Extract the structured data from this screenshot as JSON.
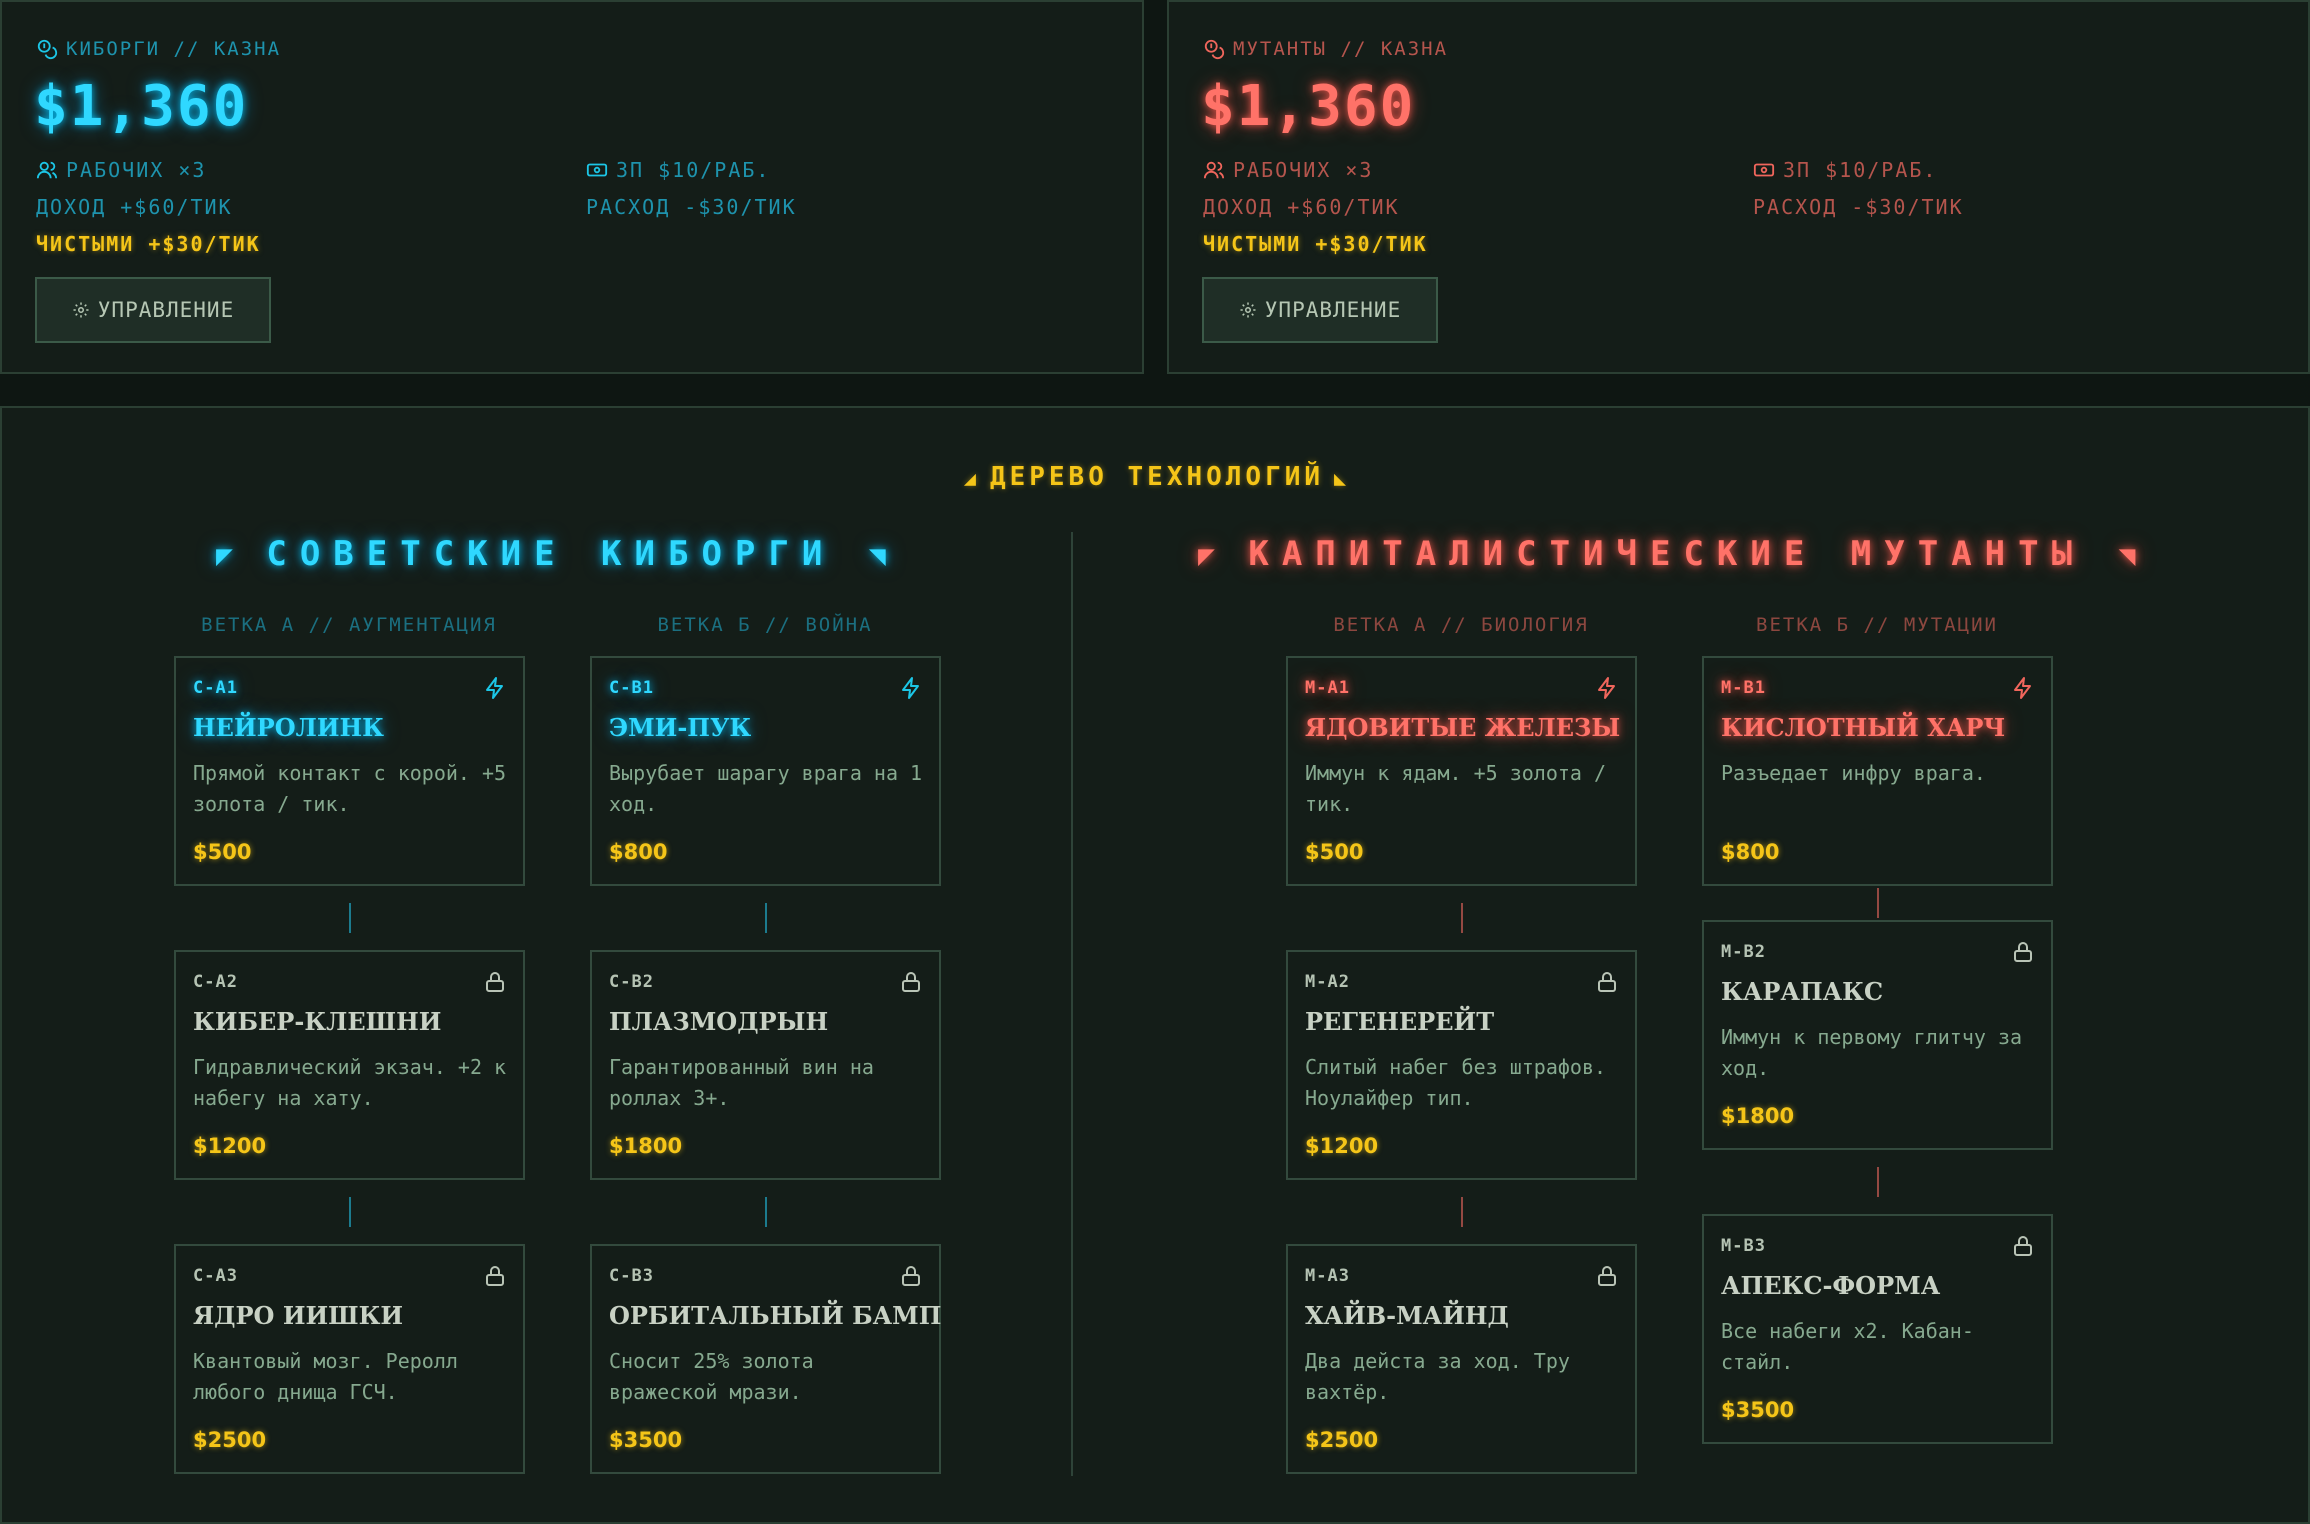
{
  "cyborgs": {
    "title": "КИБОРГИ // КАЗНА",
    "amount": "$1,360",
    "workers": "РАБОЧИХ ×3",
    "salary": "ЗП $10/РАБ.",
    "income": "ДОХОД +$60/ТИК",
    "expense": "РАСХОД -$30/ТИК",
    "net": "ЧИСТЫМИ +$30/ТИК",
    "manage": "УПРАВЛЕНИЕ"
  },
  "mutants": {
    "title": "МУТАНТЫ // КАЗНА",
    "amount": "$1,360",
    "workers": "РАБОЧИХ ×3",
    "salary": "ЗП $10/РАБ.",
    "income": "ДОХОД +$60/ТИК",
    "expense": "РАСХОД -$30/ТИК",
    "net": "ЧИСТЫМИ +$30/ТИК",
    "manage": "УПРАВЛЕНИЕ"
  },
  "tree": {
    "title": "ДЕРЕВО ТЕХНОЛОГИЙ",
    "cyborgs": {
      "faction": "СОВЕТСКИЕ КИБОРГИ",
      "branch_a": {
        "label": "ВЕТКА А // АУГМЕНТАЦИЯ",
        "cards": [
          {
            "id": "C-A1",
            "name": "НЕЙРОЛИНК",
            "desc": "Прямой контакт с корой. +5 золота / тик.",
            "price": "$500",
            "status": "available"
          },
          {
            "id": "C-A2",
            "name": "КИБЕР-КЛЕШНИ",
            "desc": "Гидравлический экзач. +2 к набегу на хату.",
            "price": "$1200",
            "status": "locked"
          },
          {
            "id": "C-A3",
            "name": "ЯДРО ИИШКИ",
            "desc": "Квантовый мозг. Реролл любого днища ГСЧ.",
            "price": "$2500",
            "status": "locked"
          }
        ]
      },
      "branch_b": {
        "label": "ВЕТКА Б // ВОЙНА",
        "cards": [
          {
            "id": "C-B1",
            "name": "ЭМИ-ПУК",
            "desc": "Вырубает шарагу врага на 1 ход.",
            "price": "$800",
            "status": "available"
          },
          {
            "id": "C-B2",
            "name": "ПЛАЗМОДРЫН",
            "desc": "Гарантированный вин на роллах 3+.",
            "price": "$1800",
            "status": "locked"
          },
          {
            "id": "C-B3",
            "name": "ОРБИТАЛЬНЫЙ БАМП",
            "desc": "Сносит 25% золота вражеской мрази.",
            "price": "$3500",
            "status": "locked"
          }
        ]
      }
    },
    "mutants": {
      "faction": "КАПИТАЛИСТИЧЕСКИЕ МУТАНТЫ",
      "branch_a": {
        "label": "ВЕТКА А // БИОЛОГИЯ",
        "cards": [
          {
            "id": "M-A1",
            "name": "ЯДОВИТЫЕ ЖЕЛЕЗЫ",
            "desc": "Иммун к ядам. +5 золота / тик.",
            "price": "$500",
            "status": "available"
          },
          {
            "id": "M-A2",
            "name": "РЕГЕНЕРЕЙТ",
            "desc": "Слитый набег без штрафов. Ноулайфер тип.",
            "price": "$1200",
            "status": "locked"
          },
          {
            "id": "M-A3",
            "name": "ХАЙВ-МАЙНД",
            "desc": "Два дейста за ход. Тру вахтёр.",
            "price": "$2500",
            "status": "locked"
          }
        ]
      },
      "branch_b": {
        "label": "ВЕТКА Б // МУТАЦИИ",
        "cards": [
          {
            "id": "M-B1",
            "name": "КИСЛОТНЫЙ ХАРЧ",
            "desc": "Разъедает инфру врага.",
            "price": "$800",
            "status": "available"
          },
          {
            "id": "M-B2",
            "name": "КАРАПАКС",
            "desc": "Иммун к первому глитчу за ход.",
            "price": "$1800",
            "status": "locked"
          },
          {
            "id": "M-B3",
            "name": "АПЕКС-ФОРМА",
            "desc": "Все набеги x2. Кабан-стайл.",
            "price": "$3500",
            "status": "locked"
          }
        ]
      }
    }
  },
  "colors": {
    "cyan": "#2fd8ff",
    "red": "#ff7268",
    "gold": "#f5c518",
    "bg": "#141d18"
  },
  "icons": {
    "treasury": "coins-icon",
    "workers": "users-icon",
    "salary": "banknote-icon",
    "manage": "gear-icon",
    "available": "lightning-icon",
    "locked": "lock-icon"
  }
}
